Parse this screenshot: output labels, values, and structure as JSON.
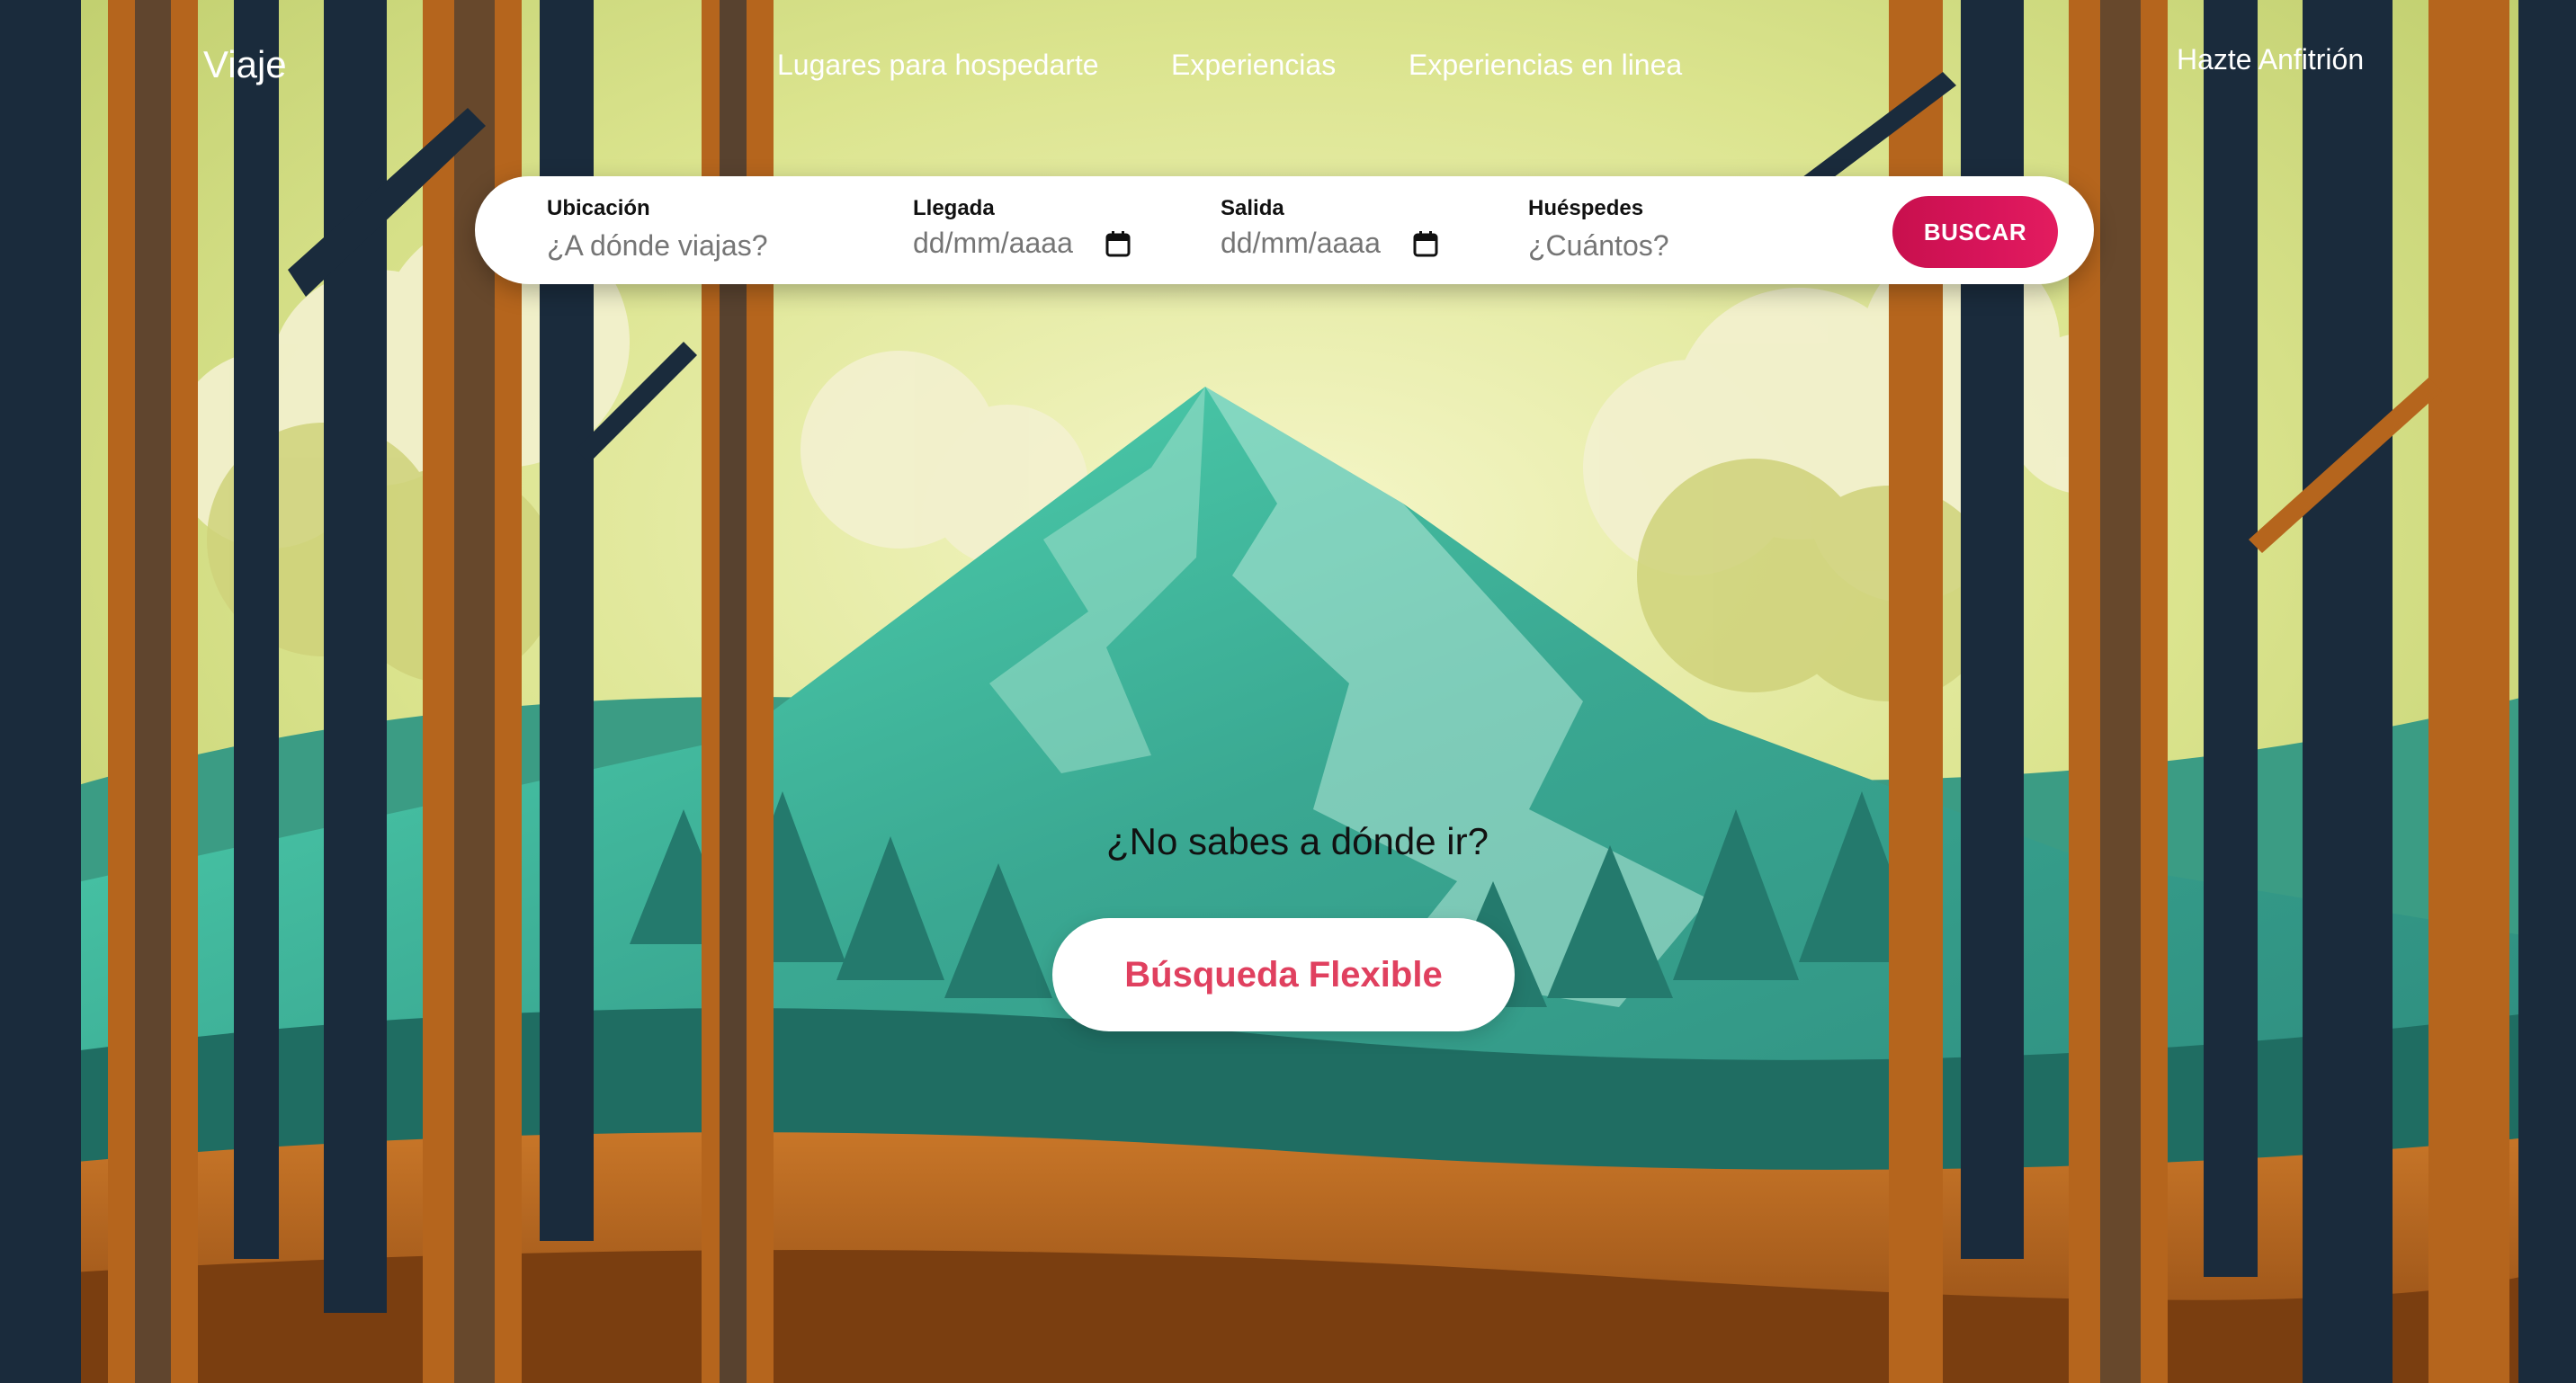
{
  "brand": {
    "name": "Viaje"
  },
  "nav": {
    "links": [
      "Lugares para hospedarte",
      "Experiencias",
      "Experiencias en linea"
    ],
    "host_link": "Hazte Anfitrión"
  },
  "search": {
    "location": {
      "label": "Ubicación",
      "placeholder": "¿A dónde viajas?"
    },
    "checkin": {
      "label": "Llegada",
      "value": "dd/mm/aaaa",
      "icon": "calendar-icon"
    },
    "checkout": {
      "label": "Salida",
      "value": "dd/mm/aaaa",
      "icon": "calendar-icon"
    },
    "guests": {
      "label": "Huéspedes",
      "placeholder": "¿Cuántos?"
    },
    "button_label": "BUSCAR"
  },
  "hero": {
    "question": "¿No sabes a dónde ir?",
    "flex_button": "Búsqueda Flexible"
  },
  "colors": {
    "accent": "#d7145a",
    "flex_text": "#e0405f",
    "sky": "#e9ea9c",
    "mountain": "#2f9c8e",
    "trunk_dark": "#1a2b3c",
    "trunk_orange": "#b5651d"
  }
}
